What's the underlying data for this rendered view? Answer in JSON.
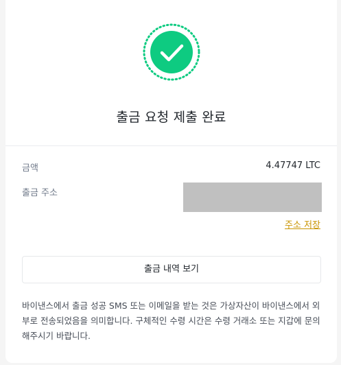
{
  "title": "출금 요청 제출 완료",
  "amount": {
    "label": "금액",
    "value": "4.47747 LTC"
  },
  "address": {
    "label": "출금 주소"
  },
  "save_address_link": "주소 저장",
  "view_history_button": "출금 내역 보기",
  "notice": "바이낸스에서 출금 성공 SMS 또는 이메일을 받는 것은 가상자산이 바이낸스에서 외부로 전송되었음을 의미합니다. 구체적인 수령 시간은 수령 거래소 또는 지갑에 문의해주시기 바랍니다.",
  "icons": {
    "success": "check-circle-icon"
  },
  "colors": {
    "success_green": "#0ecb81",
    "link_gold": "#c99400",
    "text_primary": "#1e2329",
    "text_secondary": "#707a8a"
  }
}
